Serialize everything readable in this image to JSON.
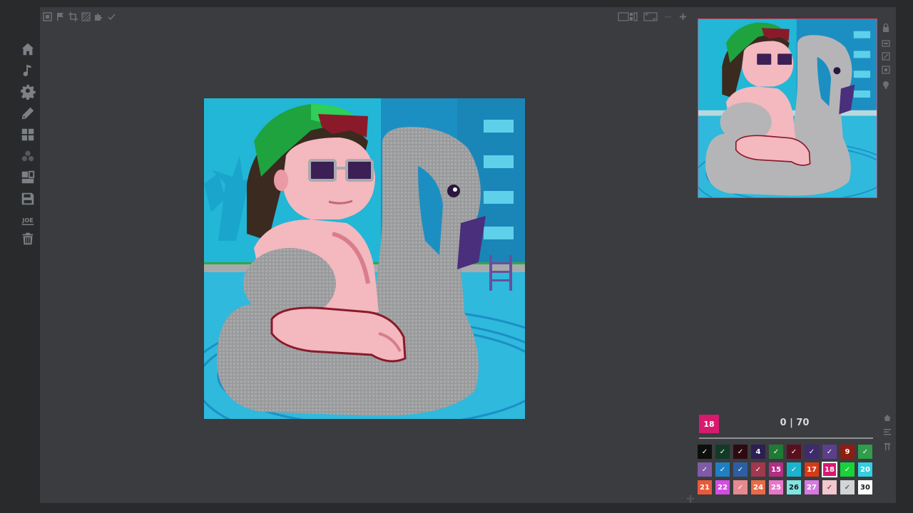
{
  "app": {
    "frame_color": "#3a3c3f",
    "bg_color": "#282a2c"
  },
  "sidebar": {
    "items": [
      {
        "name": "home-icon",
        "label": "Home"
      },
      {
        "name": "music-icon",
        "label": "Music"
      },
      {
        "name": "gear-icon",
        "label": "Settings"
      },
      {
        "name": "pencil-icon",
        "label": "Edit"
      },
      {
        "name": "grid-icon",
        "label": "Gallery"
      },
      {
        "name": "cluster-icon",
        "label": "Cluster"
      },
      {
        "name": "export-icon",
        "label": "Export"
      },
      {
        "name": "save-icon",
        "label": "Save"
      },
      {
        "name": "joe-icon",
        "label": "JOE"
      },
      {
        "name": "trash-icon",
        "label": "Delete"
      }
    ]
  },
  "toolbar": {
    "left_icons": [
      "frame-icon",
      "flag-icon",
      "crop-icon",
      "pattern-icon",
      "puzzle-icon",
      "check-icon"
    ],
    "right_icons": [
      "layout-icon",
      "fullscreen-icon",
      "minus-icon",
      "plus-icon"
    ]
  },
  "right_tools": [
    "lock-icon",
    "layer-icon",
    "resize-icon",
    "fit-icon",
    "bulb-icon"
  ],
  "status": {
    "selected_color": "18",
    "selected_hex": "#d61a6e",
    "progress_text": "0 | 70",
    "progress_value": 0,
    "progress_total": 70
  },
  "palette": {
    "rows": [
      [
        {
          "label": "✓",
          "color": "#0d0f0d",
          "text": "#ffffff"
        },
        {
          "label": "✓",
          "color": "#123a26",
          "text": "#ffffff"
        },
        {
          "label": "✓",
          "color": "#2d0a12",
          "text": "#ffffff"
        },
        {
          "label": "4",
          "color": "#2c1f52",
          "text": "#ffffff"
        },
        {
          "label": "✓",
          "color": "#1f7a35",
          "text": "#ffffff"
        },
        {
          "label": "✓",
          "color": "#5a0f1f",
          "text": "#ffffff"
        },
        {
          "label": "✓",
          "color": "#402a6e",
          "text": "#ffffff"
        },
        {
          "label": "✓",
          "color": "#5b3f8c",
          "text": "#ffffff"
        },
        {
          "label": "9",
          "color": "#8e1d12",
          "text": "#ffffff"
        },
        {
          "label": "✓",
          "color": "#2f9d4a",
          "text": "#ffffff"
        }
      ],
      [
        {
          "label": "✓",
          "color": "#7f5aa6",
          "text": "#ffffff"
        },
        {
          "label": "✓",
          "color": "#1f7fc3",
          "text": "#ffffff"
        },
        {
          "label": "✓",
          "color": "#2d5ea3",
          "text": "#ffffff"
        },
        {
          "label": "✓",
          "color": "#a0384e",
          "text": "#ffffff"
        },
        {
          "label": "15",
          "color": "#b22e83",
          "text": "#ffffff"
        },
        {
          "label": "✓",
          "color": "#1ab4d0",
          "text": "#ffffff"
        },
        {
          "label": "17",
          "color": "#d83a17",
          "text": "#ffffff"
        },
        {
          "label": "18",
          "color": "#d61a6e",
          "text": "#ffffff"
        },
        {
          "label": "✓",
          "color": "#18d23a",
          "text": "#ffffff"
        },
        {
          "label": "20",
          "color": "#32d0e0",
          "text": "#ffffff"
        }
      ],
      [
        {
          "label": "21",
          "color": "#e85a3c",
          "text": "#ffffff"
        },
        {
          "label": "22",
          "color": "#d34ee0",
          "text": "#ffffff"
        },
        {
          "label": "✓",
          "color": "#e58a8f",
          "text": "#ffffff"
        },
        {
          "label": "24",
          "color": "#e86a47",
          "text": "#ffffff"
        },
        {
          "label": "25",
          "color": "#e876c8",
          "text": "#ffffff"
        },
        {
          "label": "26",
          "color": "#7fe6e0",
          "text": "#1a1a1a"
        },
        {
          "label": "27",
          "color": "#d57be0",
          "text": "#ffffff"
        },
        {
          "label": "✓",
          "color": "#f2c7cd",
          "text": "#333333"
        },
        {
          "label": "✓",
          "color": "#d3d4d6",
          "text": "#333333"
        },
        {
          "label": "30",
          "color": "#ffffff",
          "text": "#1a1a1a"
        }
      ]
    ]
  },
  "artwork": {
    "sky": "#22b7d6",
    "building": "#1c8fc2",
    "water": "#2fb9dc",
    "cap": "#1fa33f",
    "hair": "#8a1a2a",
    "skin": "#f4b8bf",
    "unpainted": "#a9aaac",
    "glasses": "#3b1f55"
  }
}
